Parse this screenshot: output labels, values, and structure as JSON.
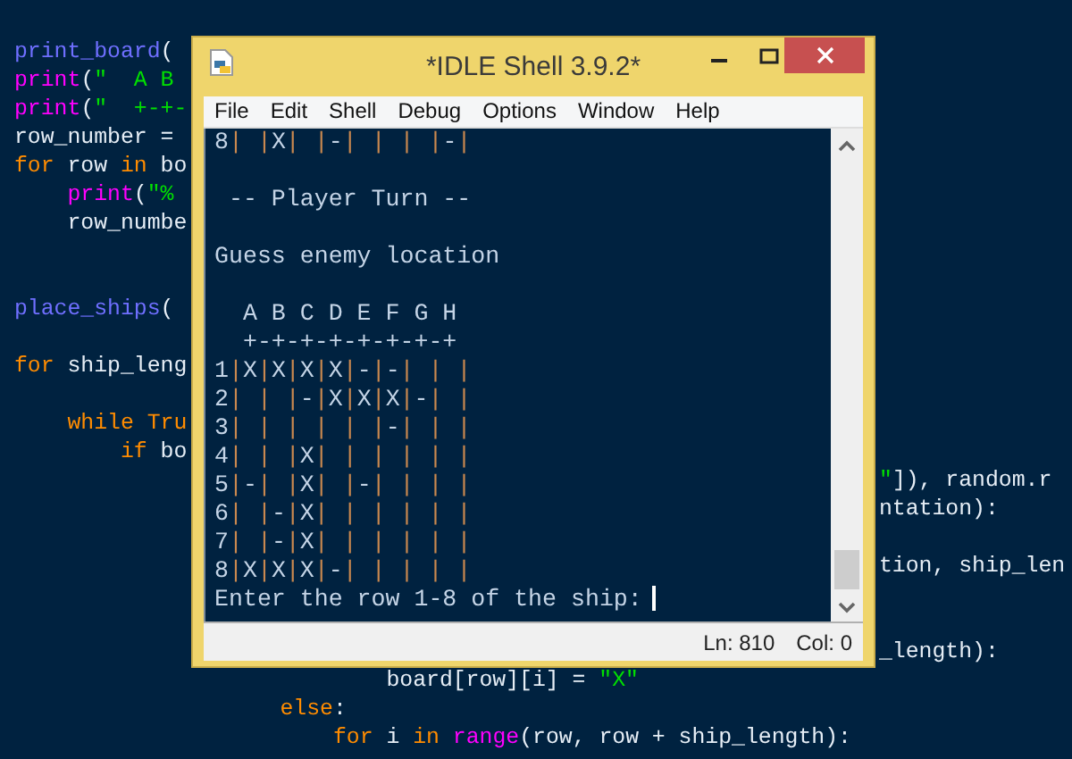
{
  "editor": {
    "lines": [
      {
        "kind": "code",
        "left": [
          {
            "text": "print_board",
            "kind": "call"
          },
          {
            "text": "(",
            "kind": "plain"
          }
        ]
      },
      {
        "kind": "code",
        "left": [
          {
            "text": "print",
            "kind": "builtin"
          },
          {
            "text": "(",
            "kind": "plain"
          },
          {
            "text": "\"  A B",
            "kind": "string"
          }
        ]
      },
      {
        "kind": "code",
        "left": [
          {
            "text": "print",
            "kind": "builtin"
          },
          {
            "text": "(",
            "kind": "plain"
          },
          {
            "text": "\"  +-+-",
            "kind": "string"
          }
        ]
      },
      {
        "kind": "code",
        "left": [
          {
            "text": "row_number =",
            "kind": "plain"
          }
        ]
      },
      {
        "kind": "code",
        "left": [
          {
            "text": "for",
            "kind": "keyword"
          },
          {
            "text": " row ",
            "kind": "plain"
          },
          {
            "text": "in",
            "kind": "keyword"
          },
          {
            "text": " bo",
            "kind": "plain"
          }
        ]
      },
      {
        "kind": "code",
        "left": [
          {
            "text": "    print",
            "kind": "builtin"
          },
          {
            "text": "(",
            "kind": "plain"
          },
          {
            "text": "\"%",
            "kind": "string"
          }
        ]
      },
      {
        "kind": "code",
        "left": [
          {
            "text": "    row_numbe",
            "kind": "plain"
          }
        ]
      },
      {
        "kind": "blank"
      },
      {
        "kind": "blank"
      },
      {
        "kind": "code",
        "left": [
          {
            "text": "place_ships",
            "kind": "call"
          },
          {
            "text": "(",
            "kind": "plain"
          }
        ]
      },
      {
        "kind": "blank"
      },
      {
        "kind": "code",
        "left": [
          {
            "text": "for",
            "kind": "keyword"
          },
          {
            "text": " ship_leng",
            "kind": "plain"
          }
        ]
      },
      {
        "kind": "blank"
      },
      {
        "kind": "code",
        "left": [
          {
            "text": "    while",
            "kind": "keyword"
          },
          {
            "text": " Tru",
            "kind": "keyword"
          }
        ]
      },
      {
        "kind": "code",
        "left": [
          {
            "text": "        if",
            "kind": "keyword"
          },
          {
            "text": " bo",
            "kind": "plain"
          }
        ]
      },
      {
        "kind": "code",
        "right": [
          {
            "text": "\"",
            "kind": "string"
          },
          {
            "text": "]), random.r",
            "kind": "plain"
          }
        ]
      },
      {
        "kind": "code",
        "right": [
          {
            "text": "ntation):",
            "kind": "plain"
          }
        ]
      },
      {
        "kind": "blank"
      },
      {
        "kind": "code",
        "right": [
          {
            "text": "tion, ship_len",
            "kind": "plain"
          }
        ]
      },
      {
        "kind": "blank"
      },
      {
        "kind": "blank"
      },
      {
        "kind": "code",
        "right": [
          {
            "text": "_length):",
            "kind": "plain"
          }
        ]
      },
      {
        "kind": "code",
        "left": [
          {
            "text": "                            board[row][i] = ",
            "kind": "plain"
          },
          {
            "text": "\"X\"",
            "kind": "string"
          }
        ]
      },
      {
        "kind": "code",
        "left": [
          {
            "text": "                    else",
            "kind": "keyword"
          },
          {
            "text": ":",
            "kind": "plain"
          }
        ]
      },
      {
        "kind": "code",
        "left": [
          {
            "text": "                        for",
            "kind": "keyword"
          },
          {
            "text": " i ",
            "kind": "plain"
          },
          {
            "text": "in",
            "kind": "keyword"
          },
          {
            "text": " range",
            "kind": "builtin"
          },
          {
            "text": "(row, row + ship_length):",
            "kind": "plain"
          }
        ]
      }
    ]
  },
  "window": {
    "title": "*IDLE Shell 3.9.2*",
    "menu": [
      "File",
      "Edit",
      "Shell",
      "Debug",
      "Options",
      "Window",
      "Help"
    ],
    "shell_lines": [
      {
        "kind": "text",
        "text": "8| |X| |-| | | |-|"
      },
      {
        "kind": "blank"
      },
      {
        "kind": "text",
        "text": " -- Player Turn --"
      },
      {
        "kind": "blank"
      },
      {
        "kind": "text",
        "text": "Guess enemy location"
      },
      {
        "kind": "blank"
      },
      {
        "kind": "text",
        "text": "  A B C D E F G H"
      },
      {
        "kind": "text",
        "text": "  +-+-+-+-+-+-+-+"
      },
      {
        "kind": "text",
        "text": "1|X|X|X|X|-|-| | |"
      },
      {
        "kind": "text",
        "text": "2| | |-|X|X|X|-| |"
      },
      {
        "kind": "text",
        "text": "3| | | | | |-| | |"
      },
      {
        "kind": "text",
        "text": "4| | |X| | | | | |"
      },
      {
        "kind": "text",
        "text": "5|-| |X| |-| | | |"
      },
      {
        "kind": "text",
        "text": "6| |-|X| | | | | |"
      },
      {
        "kind": "text",
        "text": "7| |-|X| | | | | |"
      },
      {
        "kind": "text",
        "text": "8|X|X|X|-| | | | |"
      },
      {
        "kind": "prompt",
        "text": "Enter the row 1-8 of the ship:"
      }
    ],
    "status": {
      "line": "Ln: 810",
      "col": "Col: 0"
    }
  }
}
